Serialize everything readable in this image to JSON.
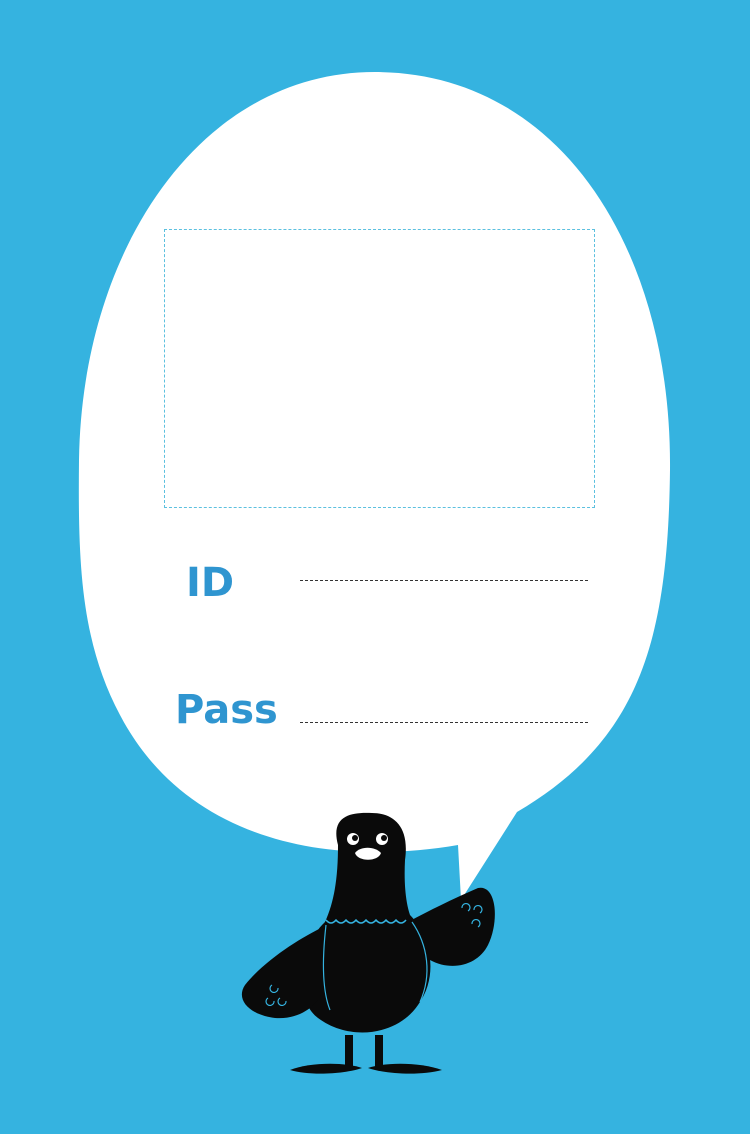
{
  "theme": {
    "background": "#35b3e0",
    "bubble": "#ffffff",
    "label_color": "#2f95d0",
    "mascot": "#0a0a0a"
  },
  "form": {
    "id_label": "ID",
    "pass_label": "Pass"
  },
  "icons": {
    "mascot": "pigeon-mascot-icon"
  }
}
